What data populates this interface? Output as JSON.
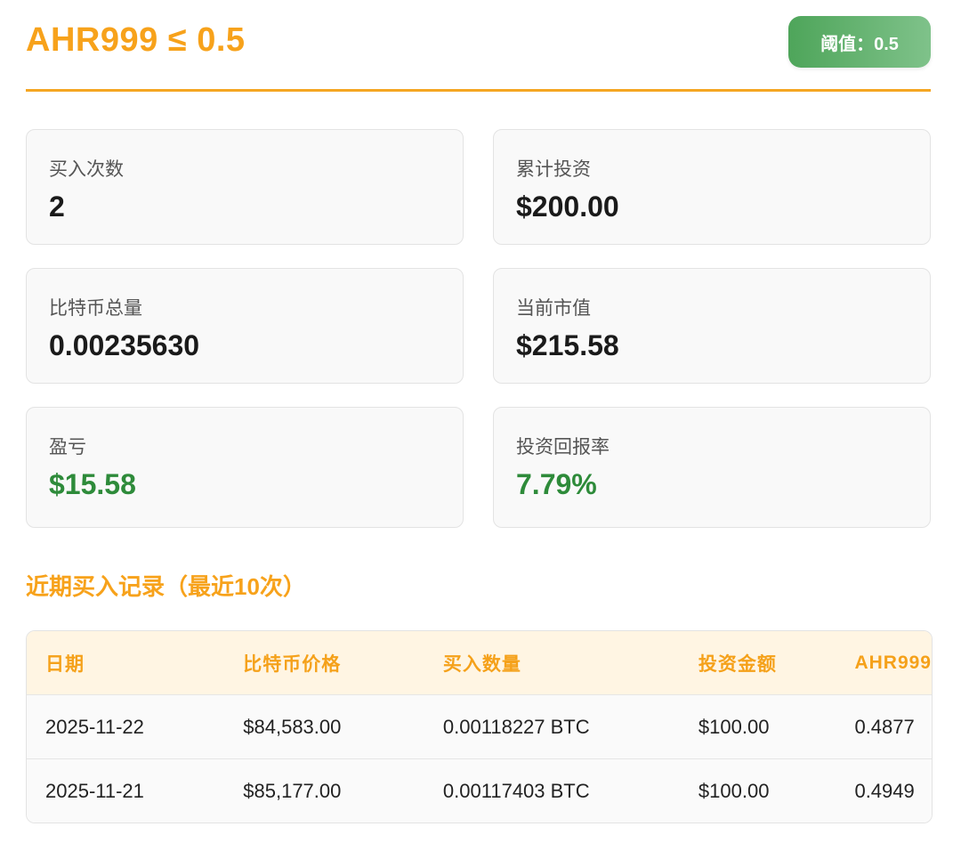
{
  "header": {
    "title": "AHR999 ≤ 0.5",
    "threshold_badge": "阈值：0.5"
  },
  "stats": {
    "buy_count": {
      "label": "买入次数",
      "value": "2"
    },
    "total_invested": {
      "label": "累计投资",
      "value": "$200.00"
    },
    "btc_total": {
      "label": "比特币总量",
      "value": "0.00235630"
    },
    "market_value": {
      "label": "当前市值",
      "value": "$215.58"
    },
    "pnl": {
      "label": "盈亏",
      "value": "$15.58"
    },
    "roi": {
      "label": "投资回报率",
      "value": "7.79%"
    }
  },
  "colors": {
    "accent": "#f7a21b",
    "positive": "#2e8b3a",
    "badge": "#5aab65"
  },
  "records": {
    "title": "近期买入记录（最近10次）",
    "columns": [
      "日期",
      "比特币价格",
      "买入数量",
      "投资金额",
      "AHR999"
    ],
    "rows": [
      [
        "2025-11-22",
        "$84,583.00",
        "0.00118227 BTC",
        "$100.00",
        "0.4877"
      ],
      [
        "2025-11-21",
        "$85,177.00",
        "0.00117403 BTC",
        "$100.00",
        "0.4949"
      ]
    ]
  }
}
